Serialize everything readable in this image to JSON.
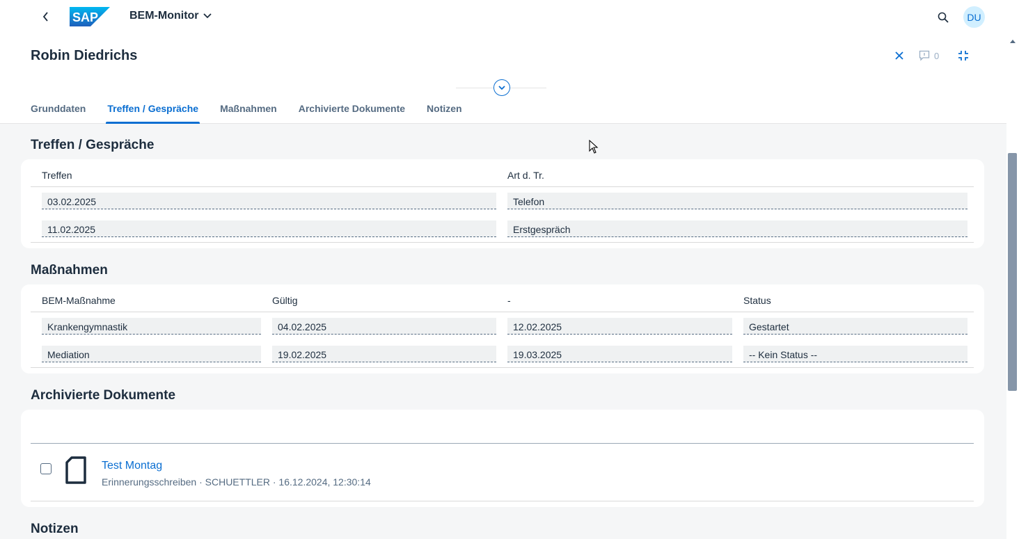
{
  "shell": {
    "app_title": "BEM-Monitor",
    "avatar_initials": "DU",
    "logo_text": "SAP"
  },
  "header": {
    "title": "Robin Diedrichs",
    "comments_count": "0"
  },
  "tabs": [
    {
      "label": "Grunddaten",
      "active": false
    },
    {
      "label": "Treffen / Gespräche",
      "active": true
    },
    {
      "label": "Maßnahmen",
      "active": false
    },
    {
      "label": "Archivierte Dokumente",
      "active": false
    },
    {
      "label": "Notizen",
      "active": false
    }
  ],
  "treffen": {
    "title": "Treffen / Gespräche",
    "columns": [
      "Treffen",
      "Art d. Tr."
    ],
    "rows": [
      [
        "03.02.2025",
        "Telefon"
      ],
      [
        "11.02.2025",
        "Erstgespräch"
      ]
    ]
  },
  "massnahmen": {
    "title": "Maßnahmen",
    "columns": [
      "BEM-Maßnahme",
      "Gültig",
      "-",
      "Status"
    ],
    "rows": [
      [
        "Krankengymnastik",
        "04.02.2025",
        "12.02.2025",
        "Gestartet"
      ],
      [
        "Mediation",
        "19.02.2025",
        "19.03.2025",
        "-- Kein Status --"
      ]
    ]
  },
  "archiv": {
    "title": "Archivierte Dokumente",
    "documents": [
      {
        "name": "Test Montag",
        "meta": "Erinnerungsschreiben · SCHUETTLER · 16.12.2024, 12:30:14"
      }
    ]
  },
  "notizen": {
    "title": "Notizen"
  },
  "colors": {
    "accent": "#0a6ed1",
    "text": "#1d2d3e",
    "background": "#f5f6f7"
  }
}
